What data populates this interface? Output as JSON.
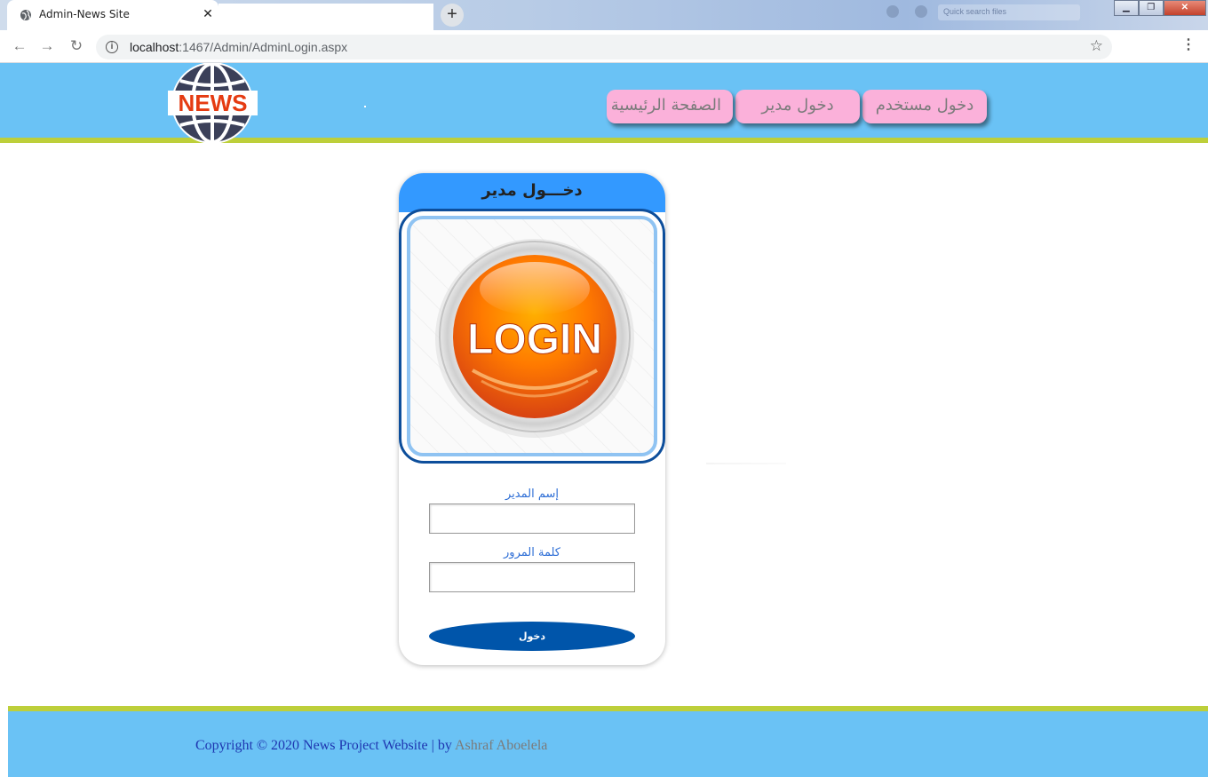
{
  "browser": {
    "tab_title": "Admin-News Site",
    "tab_close": "✕",
    "new_tab": "+",
    "url_host": "localhost",
    "url_path": ":1467/Admin/AdminLogin.aspx",
    "ghost_search": "Quick search files",
    "window_controls": [
      "▁",
      "❐",
      "✕"
    ]
  },
  "header": {
    "logo_text": "NEWS",
    "nav": [
      {
        "label": "دخول مستخدم"
      },
      {
        "label": "دخول مدير"
      },
      {
        "label": "الصفحة الرئيسية"
      }
    ]
  },
  "login_card": {
    "title": "دخـــول مدير",
    "image_text": "LOGIN",
    "username_label": "إسم المدير",
    "username_value": "",
    "password_label": "كلمة المرور",
    "password_value": "",
    "submit_label": "دخول"
  },
  "footer": {
    "copyright": "Copyright © 2020 News Project Website | by ",
    "author": "Ashraf Aboelela"
  },
  "colors": {
    "header_bg": "#6ac2f5",
    "accent_strip": "#bdcf3a",
    "nav_pink": "#fbb1da",
    "card_head": "#3399ff",
    "submit_bg": "#0055aa"
  }
}
